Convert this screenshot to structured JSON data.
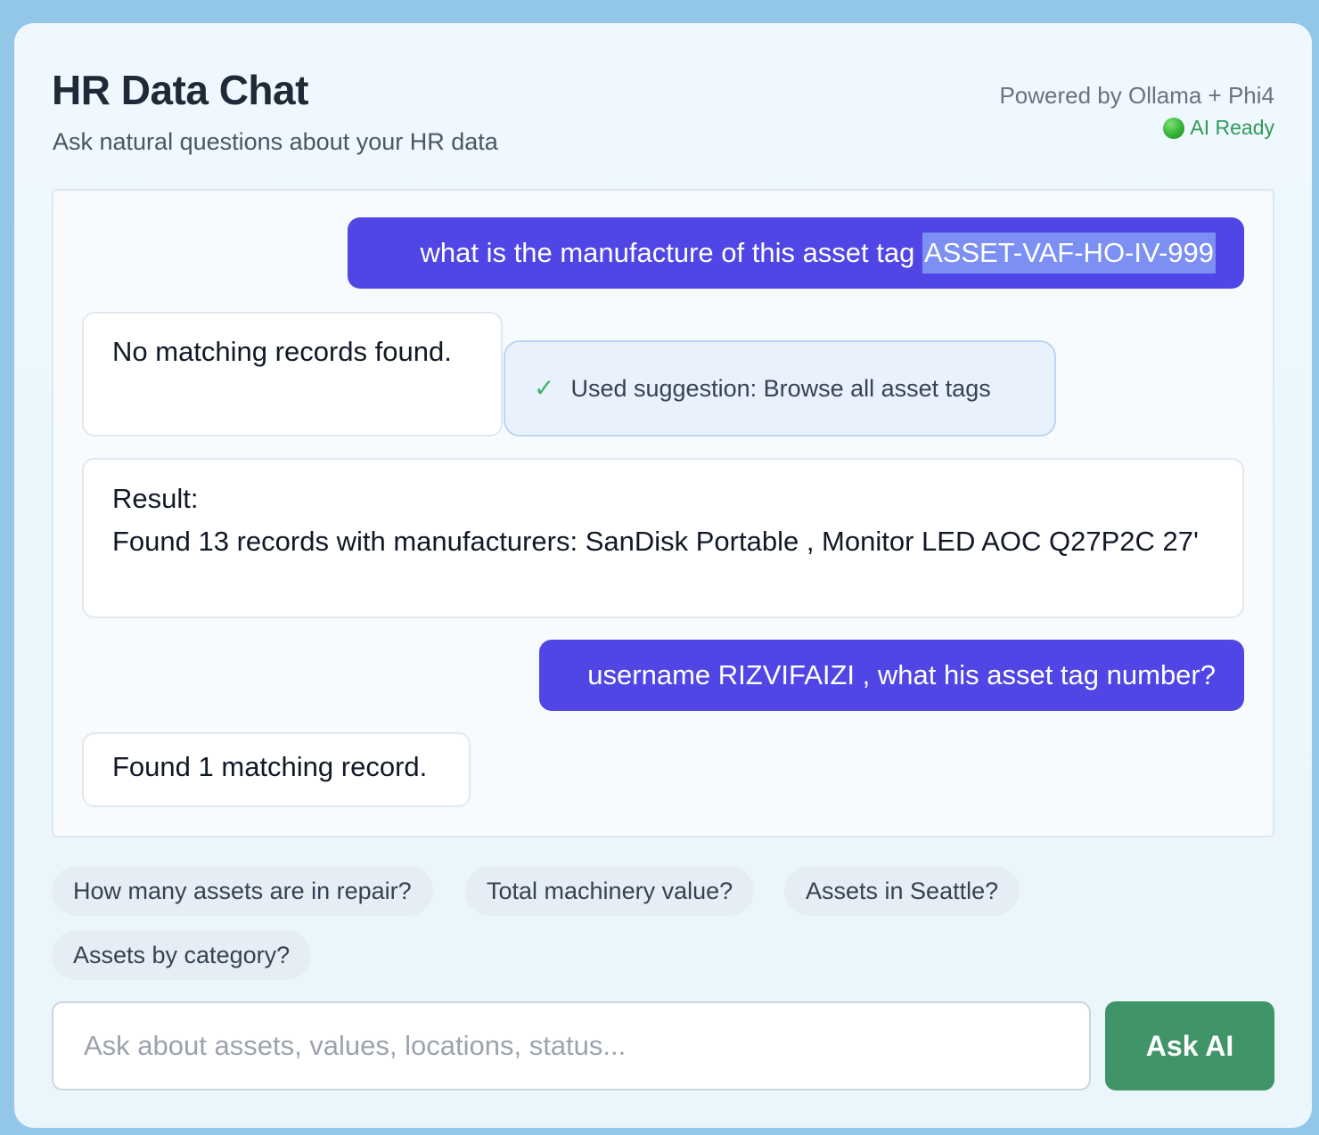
{
  "header": {
    "title": "HR Data Chat",
    "subtitle": "Ask natural questions about your HR data",
    "powered_by": "Powered by Ollama + Phi4",
    "status_text": "AI Ready",
    "status_color": "#2f9a55"
  },
  "messages": {
    "m1": {
      "role": "user",
      "text_prefix": "what is the manufacture of this asset tag ",
      "highlighted": "ASSET-VAF-HO-IV-999"
    },
    "m2": {
      "role": "ai",
      "text": "No matching records found."
    },
    "m2_suggestion": {
      "icon": "check-icon",
      "text": "Used suggestion: Browse all asset tags"
    },
    "m3": {
      "role": "ai",
      "line1": "Result:",
      "line2": "Found 13 records with manufacturers: SanDisk Portable , Monitor LED AOC Q27P2C 27'"
    },
    "m4": {
      "role": "user",
      "text": "username RIZVIFAIZI , what his asset tag number?"
    },
    "m5": {
      "role": "ai",
      "text": "Found 1 matching record."
    }
  },
  "suggestions": [
    "How many assets are in repair?",
    "Total machinery value?",
    "Assets in Seattle?",
    "Assets by category?"
  ],
  "input": {
    "placeholder": "Ask about assets, values, locations, status...",
    "value": ""
  },
  "ask_button": {
    "label": "Ask AI"
  },
  "colors": {
    "user_bubble": "#4f46e5",
    "ask_button": "#3f9468",
    "background": "#92c7e8"
  }
}
